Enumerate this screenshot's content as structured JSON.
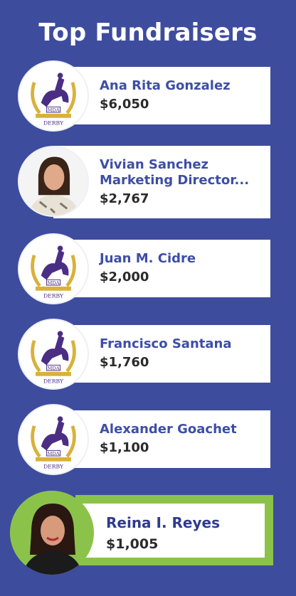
{
  "title": "Top Fundraisers",
  "logo": {
    "badge": "MDA",
    "banner": "MIAMI MOVERS DEVELOPMENT",
    "word": "DERBY"
  },
  "fundraisers": [
    {
      "name": "Ana Rita Gonzalez",
      "amount": "$6,050",
      "avatar": "derby-logo"
    },
    {
      "name_line1": "Vivian Sanchez",
      "name_line2": "Marketing Director...",
      "amount": "$2,767",
      "avatar": "photo"
    },
    {
      "name": "Juan M. Cidre",
      "amount": "$2,000",
      "avatar": "derby-logo"
    },
    {
      "name": "Francisco Santana",
      "amount": "$1,760",
      "avatar": "derby-logo"
    },
    {
      "name": "Alexander Goachet",
      "amount": "$1,100",
      "avatar": "derby-logo"
    }
  ],
  "featured": {
    "name": "Reina I. Reyes",
    "amount": "$1,005",
    "avatar": "photo"
  },
  "colors": {
    "background": "#3e4c9e",
    "name_text": "#3d4ea6",
    "highlight": "#8bc34a"
  }
}
